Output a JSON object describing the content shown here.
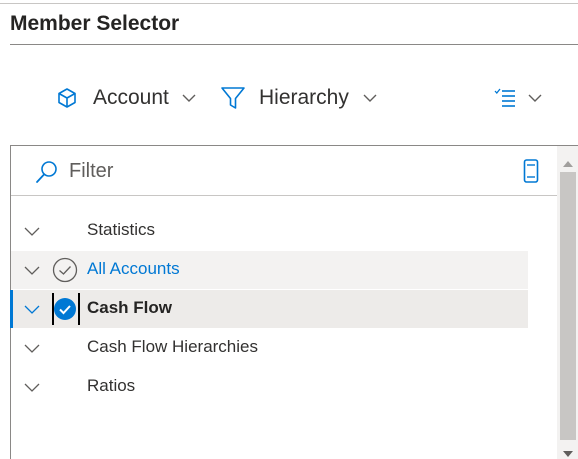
{
  "header": {
    "title": "Member Selector"
  },
  "toolbar": {
    "dimension_label": "Account",
    "hierarchy_label": "Hierarchy"
  },
  "filter": {
    "placeholder": "Filter"
  },
  "tree": {
    "items": [
      {
        "label": "Statistics",
        "state": "none"
      },
      {
        "label": "All Accounts",
        "state": "partial"
      },
      {
        "label": "Cash Flow",
        "state": "checked"
      },
      {
        "label": "Cash Flow Hierarchies",
        "state": "none"
      },
      {
        "label": "Ratios",
        "state": "none"
      }
    ]
  },
  "colors": {
    "accent": "#0078d4",
    "text": "#323130",
    "hover_row": "#f3f2f1",
    "selected_row": "#edebe9"
  },
  "icons": {
    "dimension": "cube-icon",
    "hierarchy": "filter-funnel-icon",
    "view": "checklist-icon",
    "search": "search-icon",
    "device": "mobile-device-icon",
    "expand": "chevron-down-icon"
  }
}
